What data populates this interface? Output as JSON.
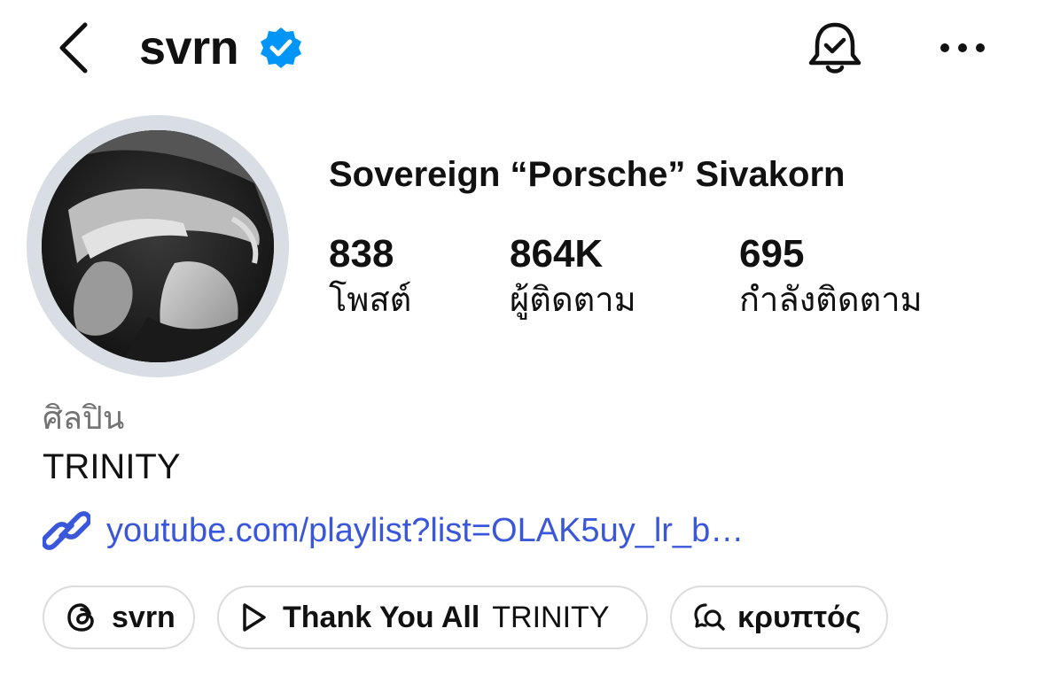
{
  "header": {
    "username": "svrn",
    "back_icon": "chevron-left-icon",
    "verified_icon": "verified-badge-icon",
    "notify_icon": "bell-check-icon",
    "more_icon": "more-horizontal-icon",
    "verified_color": "#0095f6"
  },
  "profile": {
    "full_name": "Sovereign “Porsche” Sivakorn",
    "stats": [
      {
        "value": "838",
        "label": "โพสต์"
      },
      {
        "value": "864K",
        "label": "ผู้ติดตาม"
      },
      {
        "value": "695",
        "label": "กำลังติดตาม"
      }
    ],
    "category": "ศิลปิน",
    "bio": "TRINITY",
    "link": {
      "icon": "link-icon",
      "text": "youtube.com/playlist?list=OLAK5uy_lr_b…",
      "color": "#3b57d9"
    }
  },
  "pills": [
    {
      "icon": "threads-icon",
      "label": "svrn"
    },
    {
      "icon": "play-icon",
      "label": "Thank You All",
      "sublabel": "TRINITY"
    },
    {
      "icon": "chat-search-icon",
      "label": "κρυπτός"
    }
  ]
}
